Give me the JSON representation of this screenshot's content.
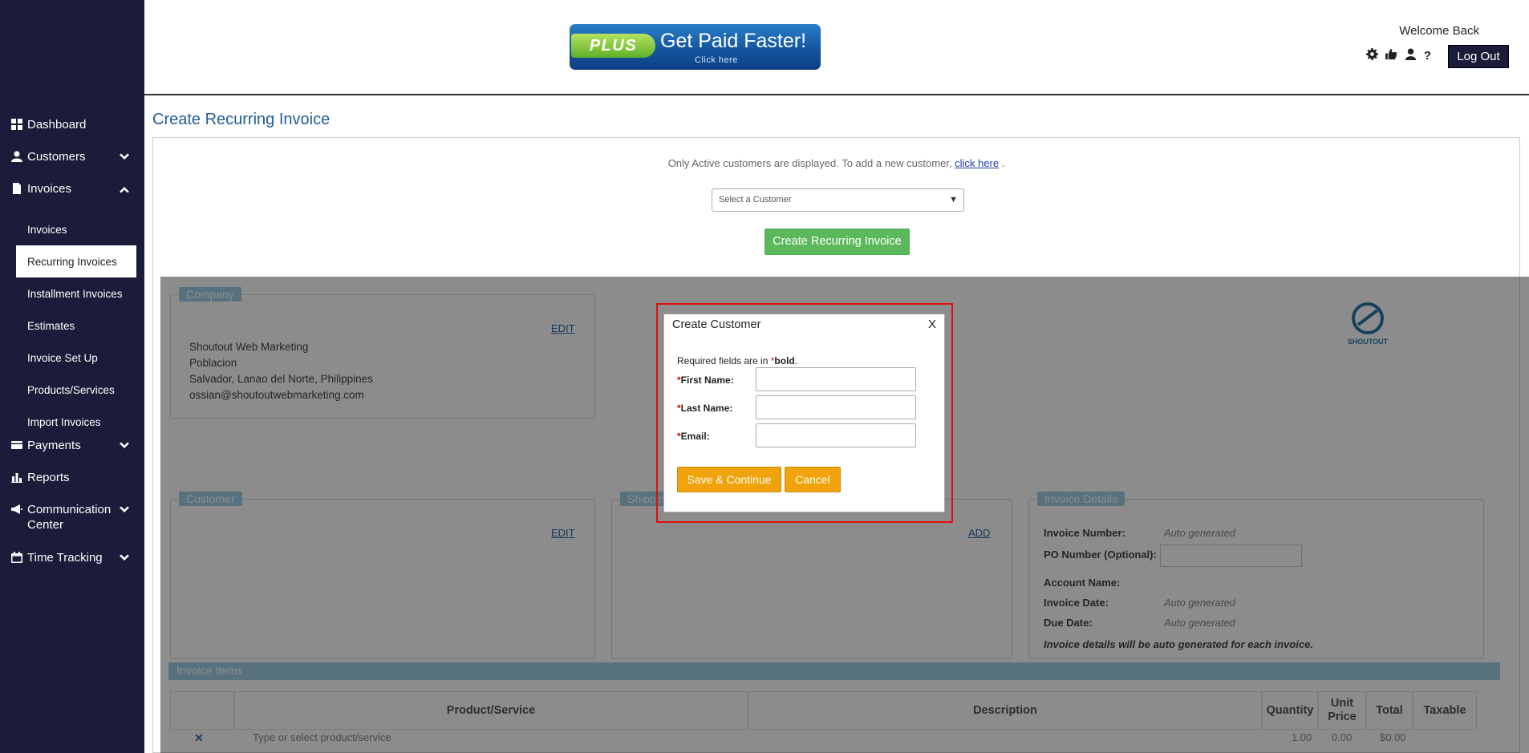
{
  "sidebar": {
    "items": [
      {
        "label": "Dashboard"
      },
      {
        "label": "Customers"
      },
      {
        "label": "Invoices"
      },
      {
        "label": "Payments"
      },
      {
        "label": "Reports"
      },
      {
        "label": "Communication Center"
      },
      {
        "label": "Time Tracking"
      }
    ],
    "invoices_sub": [
      {
        "label": "Invoices"
      },
      {
        "label": "Recurring Invoices"
      },
      {
        "label": "Installment Invoices"
      },
      {
        "label": "Estimates"
      },
      {
        "label": "Invoice Set Up"
      },
      {
        "label": "Products/Services"
      },
      {
        "label": "Import Invoices"
      }
    ]
  },
  "header": {
    "banner_plus": "PLUS",
    "banner_tagline": "Get Paid Faster!",
    "banner_click": "Click here",
    "welcome": "Welcome Back",
    "logout_label": "Log Out",
    "help_glyph": "?"
  },
  "main": {
    "title": "Create Recurring Invoice",
    "note_text": "Only Active customers are displayed. To add a new customer,",
    "note_link": "click here",
    "note_end": ".",
    "select_placeholder": "Select a Customer",
    "create_button": "Create Recurring Invoice"
  },
  "underlay": {
    "company_tag": "Company",
    "company_edit": "EDIT",
    "company_lines": [
      "Shoutout Web Marketing",
      "Poblacion",
      "Salvador, Lanao del Norte, Philippines",
      "ossian@shoutoutwebmarketing.com"
    ],
    "logo_text": "SHOUTOUT",
    "customer_tag": "Customer",
    "customer_edit": "EDIT",
    "shipping_tag": "Shipping",
    "shipping_add": "ADD",
    "details_tag": "Invoice Details",
    "invoice_number_label": "Invoice Number:",
    "invoice_number_value": "Auto generated",
    "po_label": "PO Number (Optional):",
    "account_name_label": "Account Name:",
    "invoice_date_label": "Invoice Date:",
    "invoice_date_value": "Auto generated",
    "due_date_label": "Due Date:",
    "due_date_value": "Auto generated",
    "details_note": "Invoice details will be auto generated for each invoice.",
    "items_tag": "Invoice Items",
    "col_product": "Product/Service",
    "col_description": "Description",
    "col_quantity": "Quantity",
    "col_unit_price": "Unit Price",
    "col_total": "Total",
    "col_taxable": "Taxable",
    "row_placeholder": "Type or select product/service",
    "row_qty": "1.00",
    "row_price": "0.00",
    "row_total": "$0.00"
  },
  "modal": {
    "title": "Create Customer",
    "close": "X",
    "required_prefix": "Required fields are in ",
    "required_star": "*",
    "required_bold": "bold",
    "required_suffix": ".",
    "star": "*",
    "first_name_label": "First Name:",
    "last_name_label": "Last Name:",
    "email_label": "Email:",
    "save_button": "Save & Continue",
    "cancel_button": "Cancel"
  },
  "colors": {
    "sidebar_bg": "#1b1b3a",
    "title_blue": "#1f5d96",
    "green_button": "#5cb85c",
    "orange_button": "#f0a30a",
    "highlight_red": "#e01010"
  }
}
